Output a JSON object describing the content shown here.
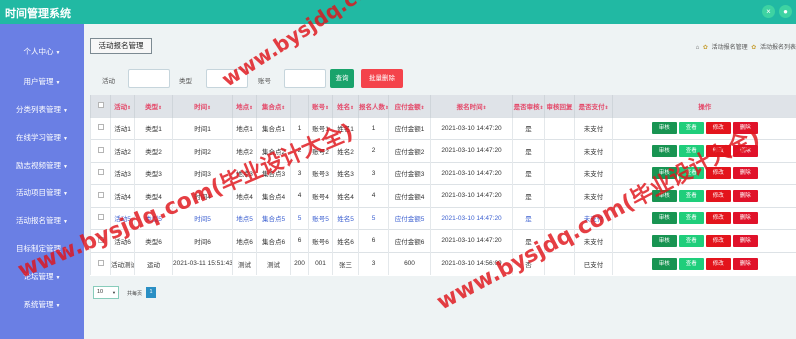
{
  "app": {
    "title": "时间管理系统",
    "colors": {
      "topbar": "#21b9a3",
      "sidebar": "#6a7fe4",
      "audit": "#189452",
      "view": "#1fce7b",
      "edit": "#e3141c",
      "delete": "#e0122a"
    }
  },
  "topbar": {
    "btn1_icon": "×",
    "btn2_icon": "●"
  },
  "sidebar": {
    "items": [
      {
        "label": "个人中心"
      },
      {
        "label": "用户管理"
      },
      {
        "label": "分类列表管理"
      },
      {
        "label": "在线学习管理"
      },
      {
        "label": "励志视频管理"
      },
      {
        "label": "活动项目管理"
      },
      {
        "label": "活动报名管理"
      },
      {
        "label": "目标制定管理"
      },
      {
        "label": "论坛管理"
      },
      {
        "label": "系统管理"
      }
    ]
  },
  "main": {
    "page_tag": "活动报名管理",
    "breadcrumb": {
      "home_icon": "⌂",
      "sep": "✿",
      "item1": "活动报名管理",
      "item2": "活动报名列表"
    },
    "search": {
      "activity_label": "活动",
      "activity_value": "",
      "type_label": "类型",
      "type_value": "",
      "account_label": "账号",
      "account_value": "",
      "search_btn": "查询",
      "batch_delete_btn": "批量删除"
    },
    "table": {
      "headers": [
        "活动",
        "类型",
        "时间",
        "地点",
        "集合点",
        "账号",
        "姓名",
        "报名人数",
        "应付金额",
        "报名时间",
        "是否审核",
        "审核回复",
        "是否支付",
        "操作"
      ],
      "rows": [
        [
          "活动1",
          "类型1",
          "时间1",
          "地点1",
          "集合点1",
          "1",
          "账号1",
          "姓名1",
          "1",
          "应付金额1",
          "2021-03-10 14:47:20",
          "是",
          "",
          "未支付"
        ],
        [
          "活动2",
          "类型2",
          "时间2",
          "地点2",
          "集合点2",
          "2",
          "账号2",
          "姓名2",
          "2",
          "应付金额2",
          "2021-03-10 14:47:20",
          "是",
          "",
          "未支付"
        ],
        [
          "活动3",
          "类型3",
          "时间3",
          "地点3",
          "集合点3",
          "3",
          "账号3",
          "姓名3",
          "3",
          "应付金额3",
          "2021-03-10 14:47:20",
          "是",
          "",
          "未支付"
        ],
        [
          "活动4",
          "类型4",
          "时间4",
          "地点4",
          "集合点4",
          "4",
          "账号4",
          "姓名4",
          "4",
          "应付金额4",
          "2021-03-10 14:47:20",
          "是",
          "",
          "未支付"
        ],
        [
          "活动5",
          "类型5",
          "时间5",
          "地点5",
          "集合点5",
          "5",
          "账号5",
          "姓名5",
          "5",
          "应付金额5",
          "2021-03-10 14:47:20",
          "是",
          "",
          "未支付"
        ],
        [
          "活动6",
          "类型6",
          "时间6",
          "地点6",
          "集合点6",
          "6",
          "账号6",
          "姓名6",
          "6",
          "应付金额6",
          "2021-03-10 14:47:20",
          "是",
          "",
          "未支付"
        ],
        [
          "活动测试",
          "运动",
          "2021-03-11 15:51:43",
          "测试",
          "测试",
          "200",
          "001",
          "张三",
          "3",
          "600",
          "2021-03-10 14:56:09",
          "否",
          "",
          "已支付"
        ]
      ],
      "ops": {
        "audit": "审核",
        "view": "查看",
        "edit": "修改",
        "delete": "删除"
      }
    },
    "pager": {
      "page_size": "10",
      "label": "共每页",
      "current_page": "1"
    }
  },
  "watermarks": {
    "line1": "www.bysjdq.com(毕业设计大全)",
    "line2": "www.bysjdq.com(毕业设计大全)",
    "line3": "www.bysjdq.com(毕业设计大全)"
  }
}
